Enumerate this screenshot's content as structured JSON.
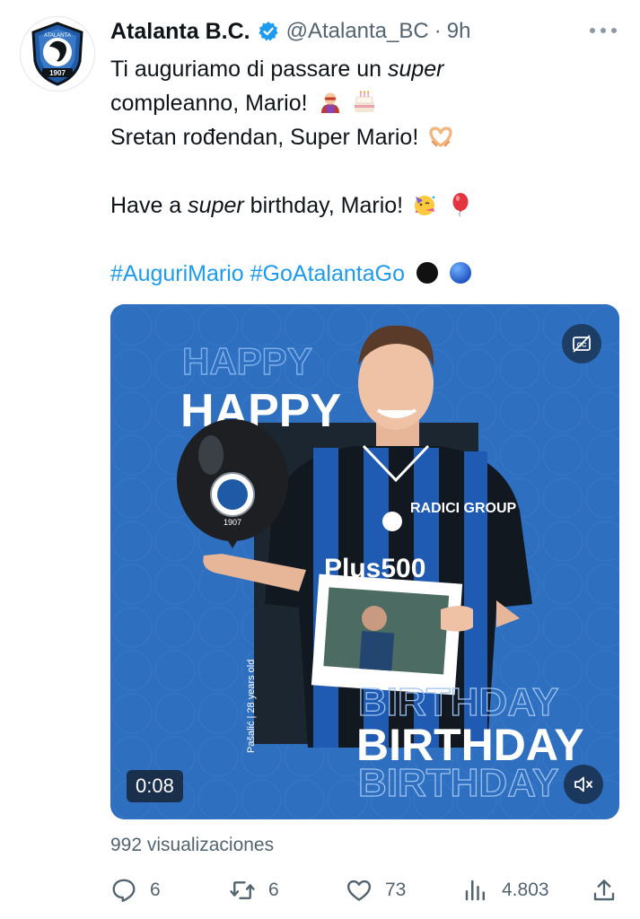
{
  "tweet": {
    "display_name": "Atalanta B.C.",
    "handle": "@Atalanta_BC",
    "separator": "·",
    "time": "9h",
    "avatar_year": "1907",
    "avatar_name": "ATALANTA",
    "line1_pre": "Ti auguriamo di passare un ",
    "line1_em": "super",
    "line2": "compleanno, Mario!",
    "line3": "Sretan rođendan, Super Mario!",
    "line4_pre": "Have a ",
    "line4_em": "super",
    "line4_post": " birthday, Mario!",
    "hashtag1": "#AuguriMario",
    "hashtag2": "#GoAtalantaGo",
    "icons": {
      "line2": [
        "superhero-emoji",
        "birthday-cake-emoji"
      ],
      "line3": [
        "heart-hands-emoji"
      ],
      "line4": [
        "partying-face-emoji",
        "balloon-emoji"
      ],
      "hashtags": [
        "black-circle-emoji",
        "blue-circle-emoji"
      ]
    }
  },
  "media": {
    "timer": "0:08",
    "happy": "HAPPY",
    "birthday": "BIRTHDAY",
    "caption": "Pašalić | 28 years old",
    "sponsor1": "RADICI GROUP",
    "sponsor2": "Plus500",
    "balloon_year": "1907"
  },
  "stats": {
    "views_label": "992 visualizaciones",
    "replies": "6",
    "retweets": "6",
    "likes": "73",
    "views": "4.803"
  },
  "colors": {
    "accent": "#1d9bf0",
    "text": "#0f1419",
    "muted": "#536471",
    "media_bg": "#2f6fc0"
  }
}
